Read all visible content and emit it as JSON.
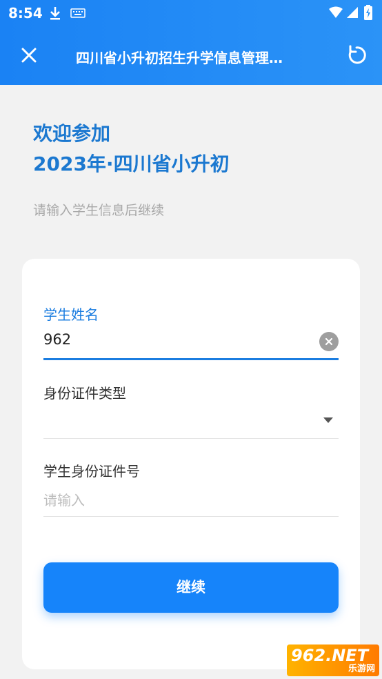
{
  "status_bar": {
    "time": "8:54"
  },
  "toolbar": {
    "title": "四川省小升初招生升学信息管理…"
  },
  "welcome": {
    "line1": "欢迎参加",
    "line2": "2023年·四川省小升初"
  },
  "subtitle": "请输入学生信息后继续",
  "form": {
    "student_name": {
      "label": "学生姓名",
      "value": "962"
    },
    "id_type": {
      "label": "身份证件类型",
      "value": ""
    },
    "id_number": {
      "label": "学生身份证件号",
      "placeholder": "请输入"
    }
  },
  "continue_label": "继续",
  "watermark": {
    "main": "962.NET",
    "sub": "乐游网"
  },
  "colors": {
    "accent": "#1684fa",
    "title_blue": "#1b78d0",
    "background": "#f2f2f2"
  }
}
